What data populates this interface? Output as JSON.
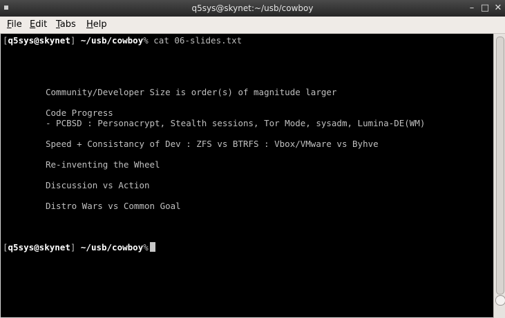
{
  "window": {
    "title": "q5sys@skynet:~/usb/cowboy",
    "minimize_glyph": "–",
    "maximize_glyph": "□",
    "close_glyph": "✕"
  },
  "menubar": {
    "file": {
      "accel": "F",
      "rest": "ile"
    },
    "edit": {
      "accel": "E",
      "rest": "dit"
    },
    "tabs": {
      "accel": "T",
      "rest": "abs"
    },
    "help": {
      "accel": "H",
      "rest": "elp"
    }
  },
  "terminal": {
    "prompt": {
      "open_bracket": "[",
      "user_host": "q5sys@skynet",
      "close_bracket": "]",
      "path": "~/usb/cowboy",
      "sign": "%"
    },
    "command": " cat 06-slides.txt",
    "slide_lines": [
      "Community/Developer Size is order(s) of magnitude larger",
      "Code Progress",
      "- PCBSD : Personacrypt, Stealth sessions, Tor Mode, sysadm, Lumina-DE(WM)",
      "Speed + Consistancy of Dev : ZFS vs BTRFS : Vbox/VMware vs Byhve",
      "Re-inventing the Wheel",
      "Discussion vs Action",
      "Distro Wars vs Common Goal"
    ]
  },
  "icons": {
    "window_menu": "window-menu-icon",
    "minimize": "minimize-icon",
    "maximize": "maximize-icon",
    "close": "close-icon"
  },
  "colors": {
    "terminal_bg": "#000000",
    "terminal_fg": "#bcbcbc",
    "prompt_bold": "#ffffff",
    "titlebar": "#333333",
    "menubar": "#efebe7"
  }
}
